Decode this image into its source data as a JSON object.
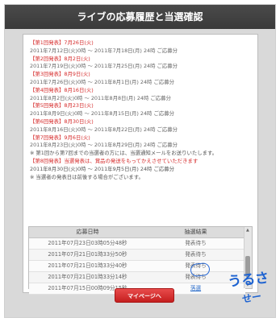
{
  "page": {
    "title": "ライブの応募履歴と当選確認"
  },
  "announcements": [
    {
      "heading": "【第1回発表】7月26日(火)",
      "range": "2011年7月12日(火)0時 ～ 2011年7月18日(月) 24時 ご応募分"
    },
    {
      "heading": "【第2回発表】8月2日(火)",
      "range": "2011年7月19日(火)0時 ～ 2011年7月25日(月) 24時 ご応募分"
    },
    {
      "heading": "【第3回発表】8月9日(火)",
      "range": "2011年7月26日(火)0時 ～ 2011年8月1日(月) 24時 ご応募分"
    },
    {
      "heading": "【第4回発表】8月16日(火)",
      "range": "2011年8月2日(火)0時 ～ 2011年8月8日(月) 24時 ご応募分"
    },
    {
      "heading": "【第5回発表】8月23日(火)",
      "range": "2011年8月9日(火)0時 ～ 2011年8月15日(月) 24時 ご応募分"
    },
    {
      "heading": "【第6回発表】8月30日(火)",
      "range": "2011年8月16日(火)0時 ～ 2011年8月22日(月) 24時 ご応募分"
    },
    {
      "heading": "【第7回発表】9月6日(火)",
      "range": "2011年8月23日(火)0時 ～ 2011年8月29日(月) 24時 ご応募分"
    }
  ],
  "notes": {
    "line1": "※ 第1回から第7回までの当選者の方には、当選通知メールをお送りいたします。",
    "line2": "【第8回発表】当選発表は、賞品の発送をもってかえさせていただきます",
    "line3": "2011年8月30日(火)0時 ～ 2011年9月5日(月) 24時 ご応募分",
    "line4": "※ 当選者の発表日は前後する場合がございます。"
  },
  "table": {
    "headers": {
      "date": "応募日時",
      "result": "抽選結果"
    },
    "rows": [
      {
        "date": "2011年07月23日03時05分48秒",
        "result": "発表待ち",
        "link": false
      },
      {
        "date": "2011年07月21日01時33分50秒",
        "result": "発表待ち",
        "link": false
      },
      {
        "date": "2011年07月21日01時33分40秒",
        "result": "発表待ち",
        "link": false
      },
      {
        "date": "2011年07月21日01時33分14秒",
        "result": "発表待ち",
        "link": false
      },
      {
        "date": "2011年07月15日00時09分15秒",
        "result": "落選",
        "link": true
      }
    ]
  },
  "buttons": {
    "mypage": "マイページへ"
  },
  "annotation": {
    "text1": "うるさ",
    "text2": "せー"
  },
  "colors": {
    "accent_red": "#d62d2d",
    "button_red": "#c51f1f",
    "link_blue": "#2a6cc9",
    "title_bg": "#3f3f3f"
  }
}
